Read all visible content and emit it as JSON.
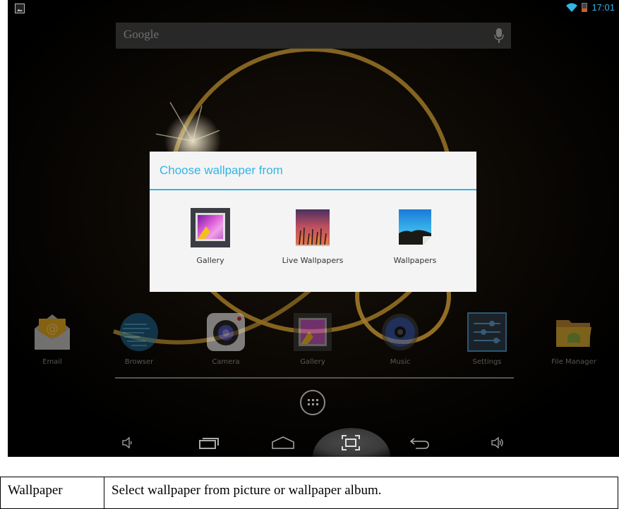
{
  "status_bar": {
    "notification_icon": "image-icon",
    "wifi_icon": "wifi-icon",
    "battery_icon": "battery-low-icon",
    "time": "17:01",
    "accent_color": "#33b5e5",
    "battery_color": "#e8580c"
  },
  "search_bar": {
    "placeholder": "Google",
    "mic_icon": "microphone-icon"
  },
  "dialog": {
    "title": "Choose wallpaper from",
    "title_color": "#33b5e5",
    "options": [
      {
        "label": "Gallery",
        "icon": "gallery-icon"
      },
      {
        "label": "Live Wallpapers",
        "icon": "live-wallpapers-icon"
      },
      {
        "label": "Wallpapers",
        "icon": "wallpapers-icon"
      }
    ]
  },
  "dock": {
    "apps": [
      {
        "label": "Email",
        "icon": "email-icon"
      },
      {
        "label": "Browser",
        "icon": "browser-globe-icon"
      },
      {
        "label": "Camera",
        "icon": "camera-icon"
      },
      {
        "label": "Gallery",
        "icon": "gallery-icon"
      },
      {
        "label": "Music",
        "icon": "music-speaker-icon"
      },
      {
        "label": "Settings",
        "icon": "settings-sliders-icon"
      },
      {
        "label": "File Manager",
        "icon": "file-manager-folder-icon"
      }
    ],
    "all_apps_icon": "all-apps-grid-icon"
  },
  "nav_bar": {
    "buttons": [
      {
        "name": "volume-down",
        "icon": "volume-down-icon"
      },
      {
        "name": "recent-apps",
        "icon": "recent-apps-icon"
      },
      {
        "name": "home",
        "icon": "home-icon"
      },
      {
        "name": "screenshot",
        "icon": "screenshot-icon"
      },
      {
        "name": "back",
        "icon": "back-icon"
      },
      {
        "name": "volume-up",
        "icon": "volume-up-icon"
      }
    ]
  },
  "doc_table": {
    "rows": [
      {
        "term": "Wallpaper",
        "description": "Select wallpaper from picture or wallpaper album."
      }
    ]
  }
}
